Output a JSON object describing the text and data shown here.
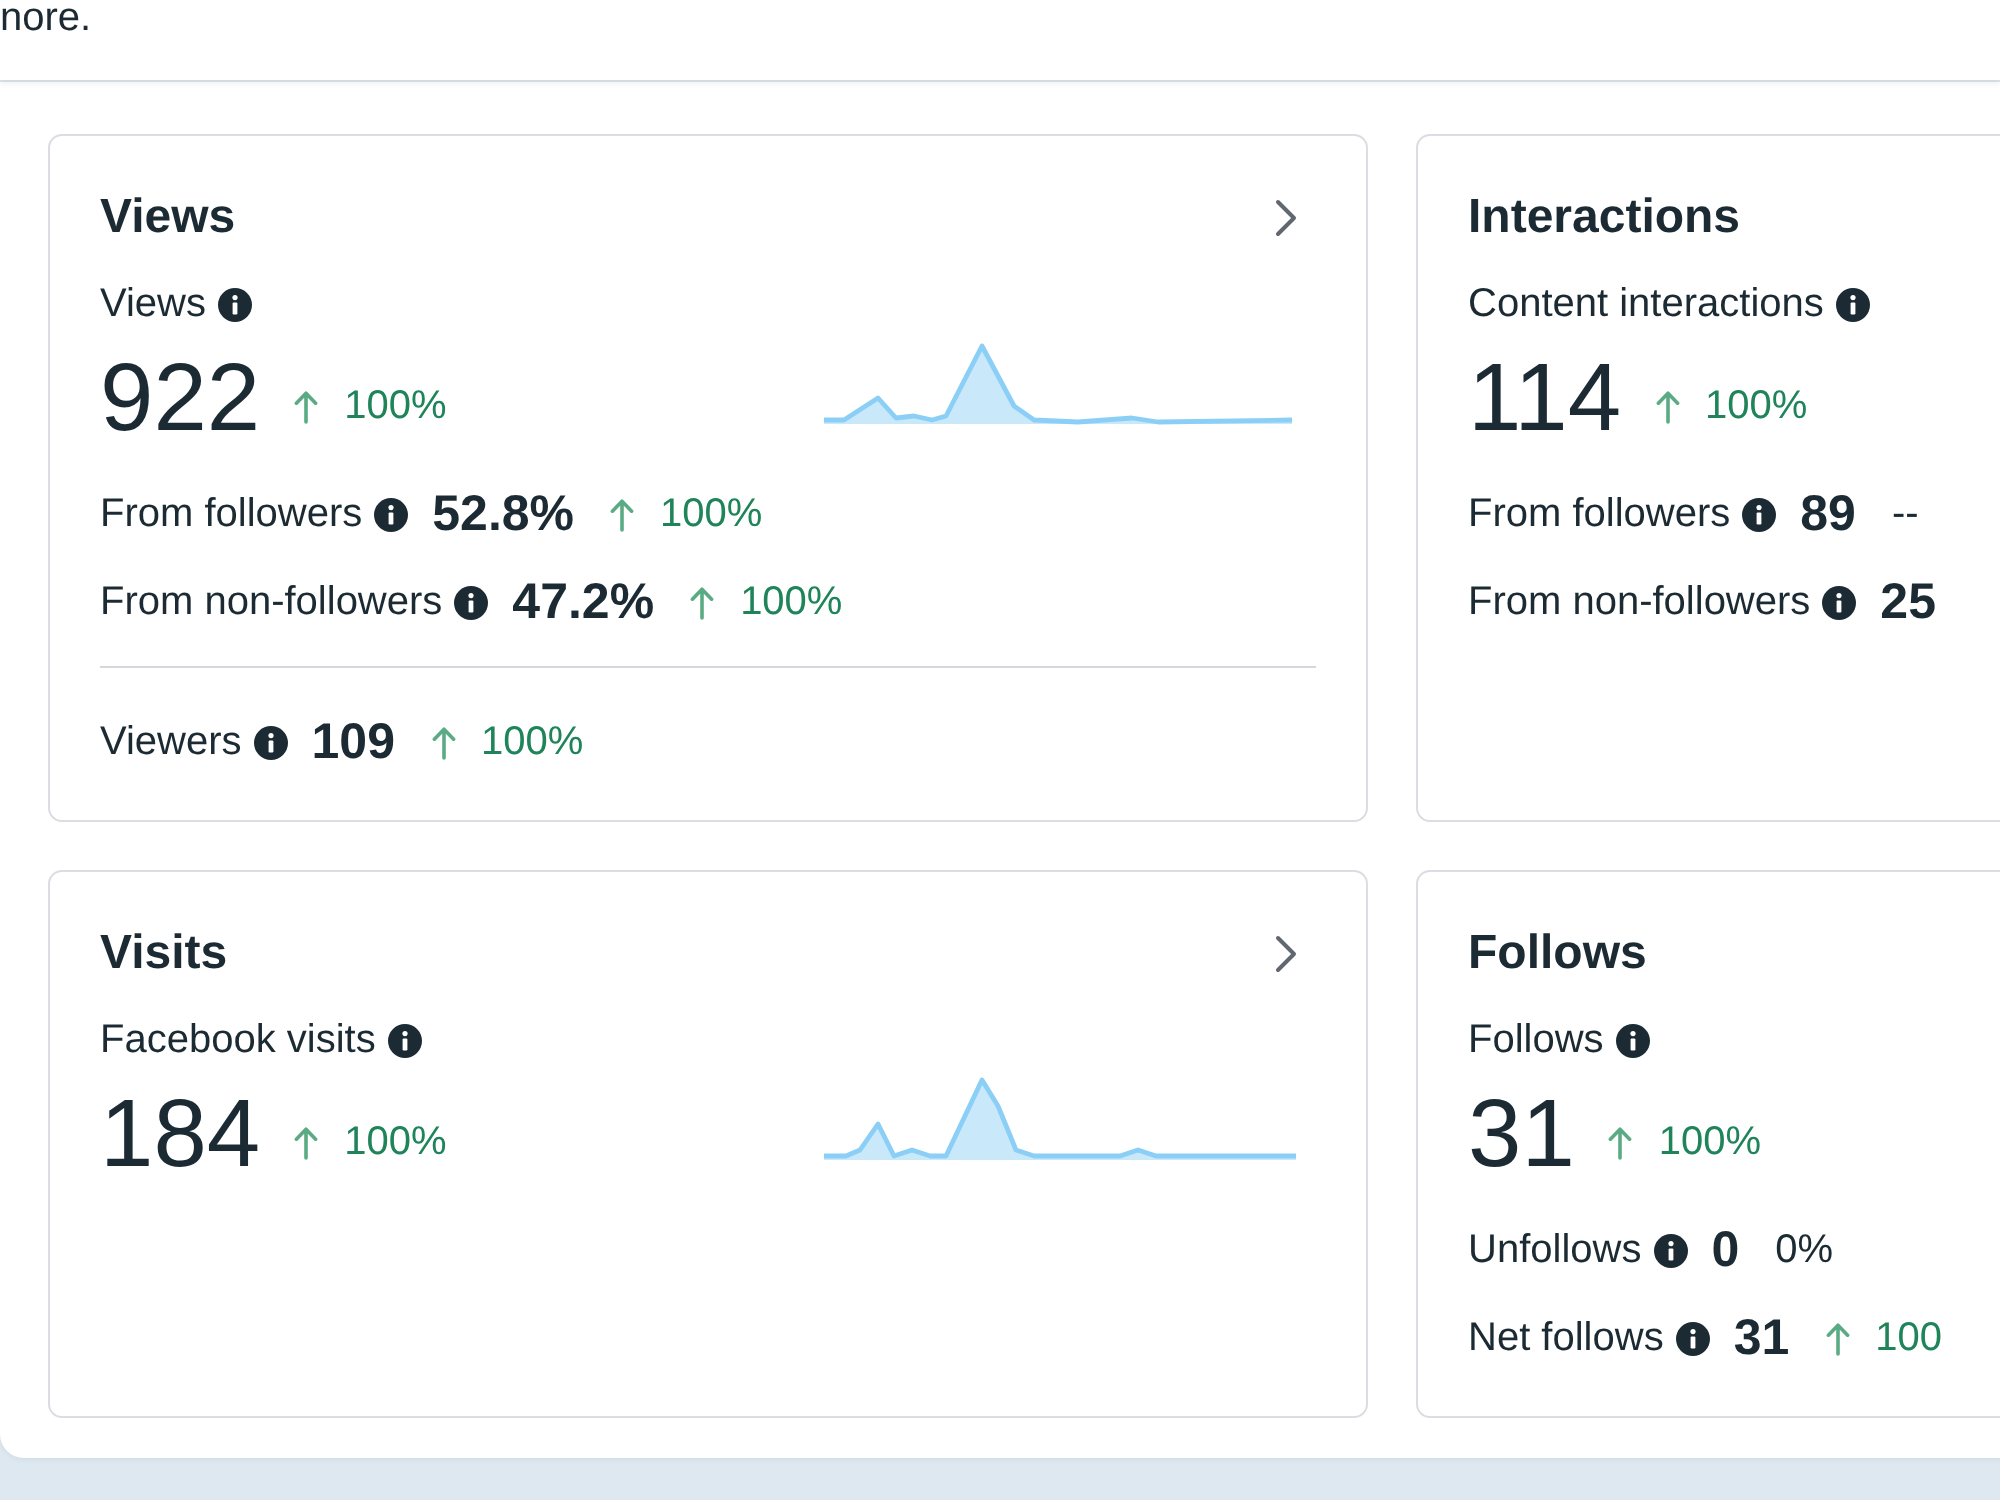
{
  "header": {
    "text": "nore."
  },
  "cards": [
    {
      "kind": "trend",
      "title": "Views",
      "metric": {
        "label": "Views",
        "value": "922",
        "change": {
          "up": true,
          "text": "100%"
        }
      },
      "breakdown": [
        {
          "label": "From followers",
          "value": "52.8%",
          "change": {
            "up": true,
            "text": "100%"
          }
        },
        {
          "label": "From non-followers",
          "value": "47.2%",
          "change": {
            "up": true,
            "text": "100%"
          }
        }
      ],
      "footer": [
        {
          "label": "Viewers",
          "value": "109",
          "change": {
            "up": true,
            "text": "100%"
          }
        }
      ]
    },
    {
      "kind": "summary",
      "title": "Interactions",
      "metric": {
        "label": "Content interactions",
        "value": "114",
        "change": {
          "up": true,
          "text": "100%"
        }
      },
      "breakdown": [
        {
          "label": "From followers",
          "value": "89",
          "change": {
            "up": false,
            "text": "--"
          }
        },
        {
          "label": "From non-followers",
          "value": "25"
        }
      ]
    },
    {
      "kind": "trend",
      "title": "Visits",
      "metric": {
        "label": "Facebook visits",
        "value": "184",
        "change": {
          "up": true,
          "text": "100%"
        }
      }
    },
    {
      "kind": "summary",
      "title": "Follows",
      "metric": {
        "label": "Follows",
        "value": "31",
        "change": {
          "up": true,
          "text": "100%"
        }
      },
      "breakdown": [
        {
          "label": "Unfollows",
          "value": "0",
          "change": {
            "up": false,
            "text": "0%"
          }
        },
        {
          "label": "Net follows",
          "value": "31",
          "change": {
            "up": true,
            "text": "100"
          }
        }
      ]
    }
  ]
}
